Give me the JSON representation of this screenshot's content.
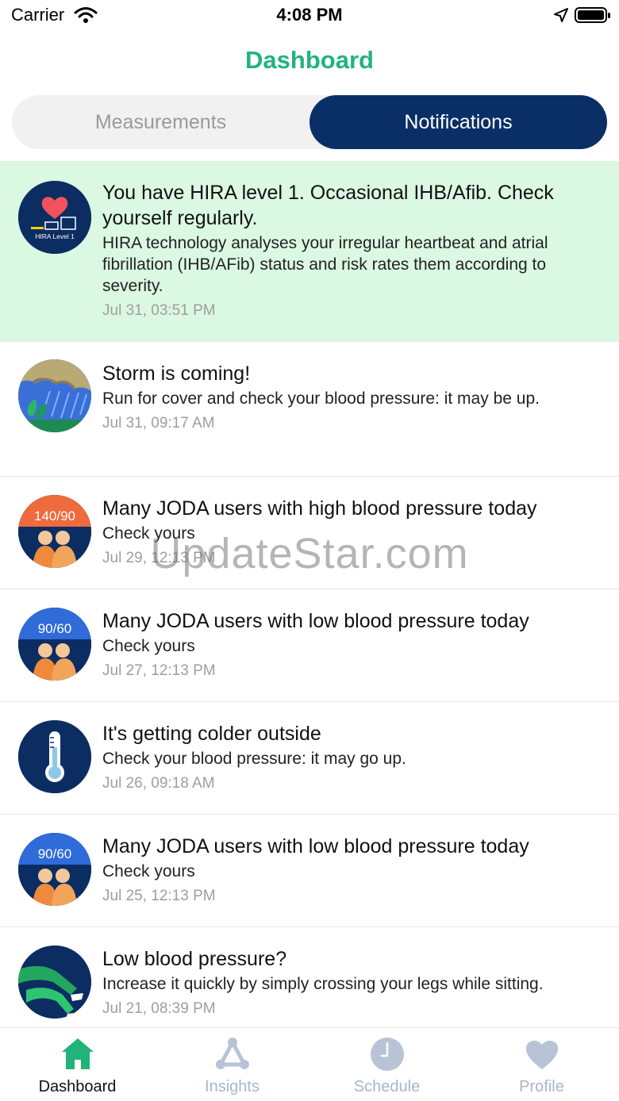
{
  "status_bar": {
    "carrier": "Carrier",
    "time": "4:08 PM"
  },
  "header": {
    "title": "Dashboard"
  },
  "segments": [
    {
      "label": "Measurements",
      "selected": false
    },
    {
      "label": "Notifications",
      "selected": true
    }
  ],
  "notifications": [
    {
      "icon": "hira-level-heart-icon",
      "icon_text": "HIRA Level 1",
      "title": "You have HIRA level 1. Occasional IHB/Afib. Check yourself regularly.",
      "text": "HIRA technology analyses your irregular heartbeat and atrial fibrillation (IHB/AFib) status and risk rates them according to severity.",
      "date": "Jul 31, 03:51 PM",
      "highlighted": true
    },
    {
      "icon": "storm-icon",
      "title": "Storm is coming!",
      "text": "Run for cover and check your blood pressure: it may be up.",
      "date": "Jul 31, 09:17 AM"
    },
    {
      "icon": "high-pressure-users-icon",
      "icon_text": "140/90",
      "title": "Many JODA users with high blood pressure today",
      "text": "Check yours",
      "date": "Jul 29, 12:13 PM"
    },
    {
      "icon": "low-pressure-users-icon",
      "icon_text": "90/60",
      "title": "Many JODA users with low blood pressure today",
      "text": "Check yours",
      "date": "Jul 27, 12:13 PM"
    },
    {
      "icon": "thermometer-icon",
      "title": "It's getting colder outside",
      "text": "Check your blood pressure: it may go up.",
      "date": "Jul 26, 09:18 AM"
    },
    {
      "icon": "low-pressure-users-icon",
      "icon_text": "90/60",
      "title": "Many JODA users with low blood pressure today",
      "text": "Check yours",
      "date": "Jul 25, 12:13 PM"
    },
    {
      "icon": "crossed-legs-icon",
      "title": "Low blood pressure?",
      "text": "Increase it quickly by simply crossing your legs while sitting.",
      "date": "Jul 21, 08:39 PM"
    }
  ],
  "tabs": [
    {
      "label": "Dashboard",
      "icon": "home-icon",
      "active": true
    },
    {
      "label": "Insights",
      "icon": "insights-icon",
      "active": false
    },
    {
      "label": "Schedule",
      "icon": "clock-icon",
      "active": false
    },
    {
      "label": "Profile",
      "icon": "heart-icon",
      "active": false
    }
  ],
  "colors": {
    "accent_green": "#21b47a",
    "navy": "#0a2f66",
    "highlight_bg": "#dbf8e2",
    "inactive_tab": "#a9b5c6"
  },
  "watermark": "UpdateStar.com"
}
